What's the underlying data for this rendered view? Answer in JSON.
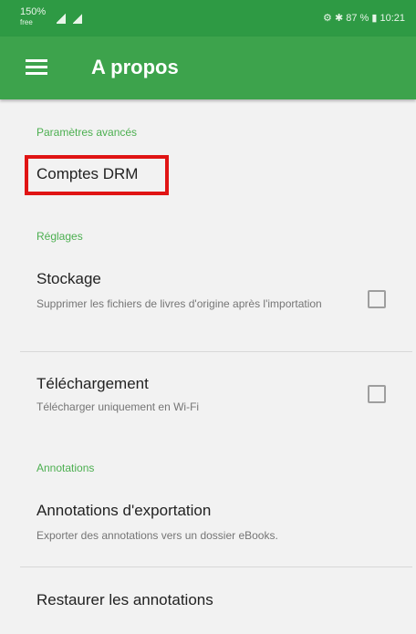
{
  "status_bar": {
    "carrier_line1": "150% ",
    "carrier_line2": "free",
    "right_text": "⚙ ✱ 87 % ▮ 10:21"
  },
  "app_bar": {
    "title": "A propos"
  },
  "sections": {
    "advanced": {
      "header": "Paramètres avancés"
    },
    "settings": {
      "header": "Réglages"
    },
    "annotations": {
      "header": "Annotations"
    }
  },
  "items": {
    "drm": {
      "title": "Comptes DRM"
    },
    "storage": {
      "title": "Stockage",
      "subtitle": "Supprimer les fichiers de livres d'origine après l'importation",
      "checked": false
    },
    "download": {
      "title": "Téléchargement",
      "subtitle": "Télécharger uniquement en Wi-Fi",
      "checked": false
    },
    "export_annotations": {
      "title": "Annotations d'exportation",
      "subtitle": "Exporter des annotations vers un dossier eBooks."
    },
    "restore_annotations": {
      "title": "Restaurer les annotations"
    }
  },
  "colors": {
    "app_bar": "#3da34c",
    "status_bar": "#2e9a44",
    "section_header": "#4caf50",
    "highlight": "#e01414"
  }
}
